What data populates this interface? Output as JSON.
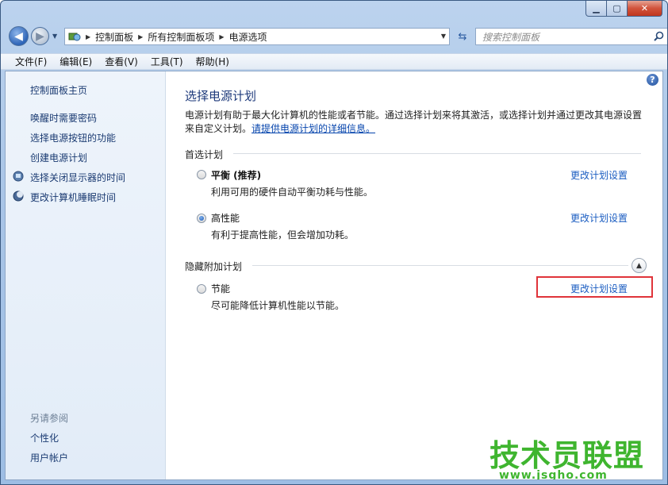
{
  "window": {
    "buttons": {
      "minimize": "▁",
      "maximize": "▢",
      "close": "✕"
    }
  },
  "nav": {
    "breadcrumbs": [
      "控制面板",
      "所有控制面板项",
      "电源选项"
    ],
    "search_placeholder": "搜索控制面板"
  },
  "menu": [
    "文件(F)",
    "编辑(E)",
    "查看(V)",
    "工具(T)",
    "帮助(H)"
  ],
  "sidebar": {
    "home": "控制面板主页",
    "links": [
      {
        "label": "唤醒时需要密码",
        "icon": null
      },
      {
        "label": "选择电源按钮的功能",
        "icon": null
      },
      {
        "label": "创建电源计划",
        "icon": null
      },
      {
        "label": "选择关闭显示器的时间",
        "icon": "monitor-icon"
      },
      {
        "label": "更改计算机睡眠时间",
        "icon": "moon-icon"
      }
    ],
    "see_also_title": "另请参阅",
    "see_also": [
      "个性化",
      "用户帐户"
    ]
  },
  "main": {
    "title": "选择电源计划",
    "desc_text": "电源计划有助于最大化计算机的性能或者节能。通过选择计划来将其激活，或选择计划并通过更改其电源设置来自定义计划。",
    "desc_link": "请提供电源计划的详细信息。",
    "preferred_heading": "首选计划",
    "hidden_heading": "隐藏附加计划",
    "plans": [
      {
        "name": "平衡 (推荐)",
        "desc": "利用可用的硬件自动平衡功耗与性能。",
        "link": "更改计划设置",
        "selected": false
      },
      {
        "name": "高性能",
        "desc": "有利于提高性能，但会增加功耗。",
        "link": "更改计划设置",
        "selected": true
      },
      {
        "name": "节能",
        "desc": "尽可能降低计算机性能以节能。",
        "link": "更改计划设置",
        "selected": false
      }
    ]
  },
  "watermark": {
    "title": "技术员联盟",
    "url": "www.jsgho.com"
  },
  "colors": {
    "link": "#1b5dc1",
    "highlight": "#e0343a",
    "watermark": "#3fb52f"
  }
}
